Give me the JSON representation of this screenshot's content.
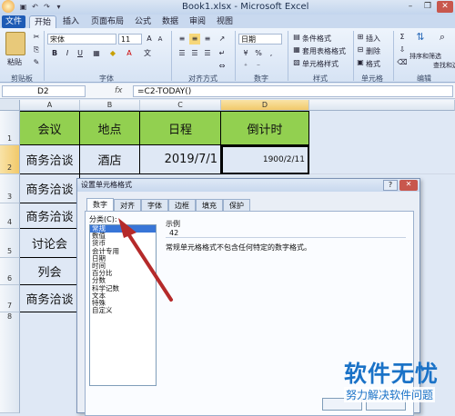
{
  "window": {
    "title": "Book1.xlsx - Microsoft Excel",
    "file_tab": "文件",
    "minimize": "–",
    "restore": "❐",
    "close": "✕"
  },
  "ribbon_tabs": [
    "开始",
    "插入",
    "页面布局",
    "公式",
    "数据",
    "审阅",
    "视图"
  ],
  "ribbon": {
    "paste_label": "粘贴",
    "clipboard_label": "剪贴板",
    "font_label": "字体",
    "align_label": "对齐方式",
    "number_label": "数字",
    "styles_label": "样式",
    "cells_label": "单元格",
    "editing_label": "编辑",
    "font_name": "宋体",
    "font_size": "11",
    "number_format": "日期",
    "cond_format": "条件格式",
    "table_format": "套用表格格式",
    "cell_styles": "单元格样式",
    "insert": "插入",
    "delete": "删除",
    "format": "格式",
    "sort_filter": "排序和筛选",
    "find_select": "查找和选择"
  },
  "formula_bar": {
    "name_box": "D2",
    "fx": "fx",
    "formula": "=C2-TODAY()"
  },
  "sheet": {
    "columns": [
      "A",
      "B",
      "C",
      "D"
    ],
    "rows": [
      "1",
      "2",
      "3",
      "4",
      "5",
      "6",
      "7",
      "8"
    ],
    "cells": [
      [
        "会议",
        "地点",
        "日程",
        "倒计时"
      ],
      [
        "商务洽谈",
        "酒店",
        "2019/7/1",
        "1900/2/11"
      ],
      [
        "商务洽谈",
        "",
        "",
        ""
      ],
      [
        "商务洽谈",
        "",
        "",
        ""
      ],
      [
        "讨论会",
        "",
        "",
        ""
      ],
      [
        "列会",
        "",
        "",
        ""
      ],
      [
        "商务洽谈",
        "",
        "",
        ""
      ]
    ],
    "header_fill": "#92d050"
  },
  "dialog": {
    "title": "设置单元格格式",
    "help": "?",
    "close": "✕",
    "tabs": [
      "数字",
      "对齐",
      "字体",
      "边框",
      "填充",
      "保护"
    ],
    "category_label": "分类(C):",
    "categories": [
      "常规",
      "数值",
      "货币",
      "会计专用",
      "日期",
      "时间",
      "百分比",
      "分数",
      "科学记数",
      "文本",
      "特殊",
      "自定义"
    ],
    "sample_label": "示例",
    "sample_value": "42",
    "description": "常规单元格格式不包含任何特定的数字格式。"
  },
  "watermark": {
    "brand": "软件无忧",
    "tagline": "努力解决软件问题"
  },
  "colors": {
    "arrow": "#b52a2a",
    "selection": "#3875d7"
  }
}
